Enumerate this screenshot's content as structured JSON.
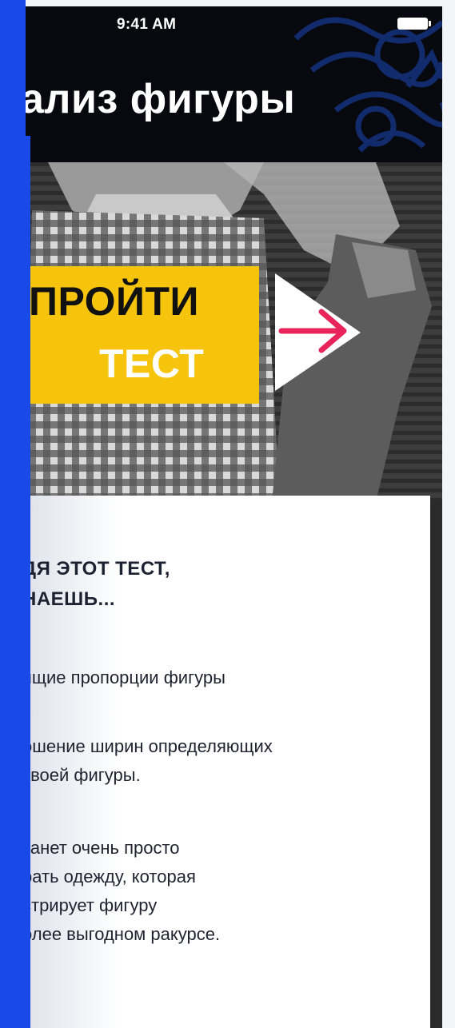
{
  "status_bar": {
    "time": "9:41 AM"
  },
  "header": {
    "title": "ализ фигуры"
  },
  "cta": {
    "line1": "ПРОЙТИ",
    "line2": "ТЕСТ"
  },
  "card": {
    "heading_lines": [
      "ДЯ ЭТОТ ТЕСТ,",
      "НАЕШЬ..."
    ],
    "paragraphs": [
      [
        "ящие пропорции фигуры"
      ],
      [
        "ошение ширин определяющих",
        "твоей фигуры."
      ],
      [
        "танет очень просто",
        "рать одежду, которая",
        "стрирует фигуру",
        "олее выгодном ракурсе."
      ]
    ]
  },
  "colors": {
    "accent_blue": "#1949e6",
    "cta_yellow": "#f6c40c",
    "arrow_pink": "#e8245a",
    "header_bg": "#07090f"
  },
  "icons": [
    "battery-icon",
    "play-arrow-icon"
  ]
}
